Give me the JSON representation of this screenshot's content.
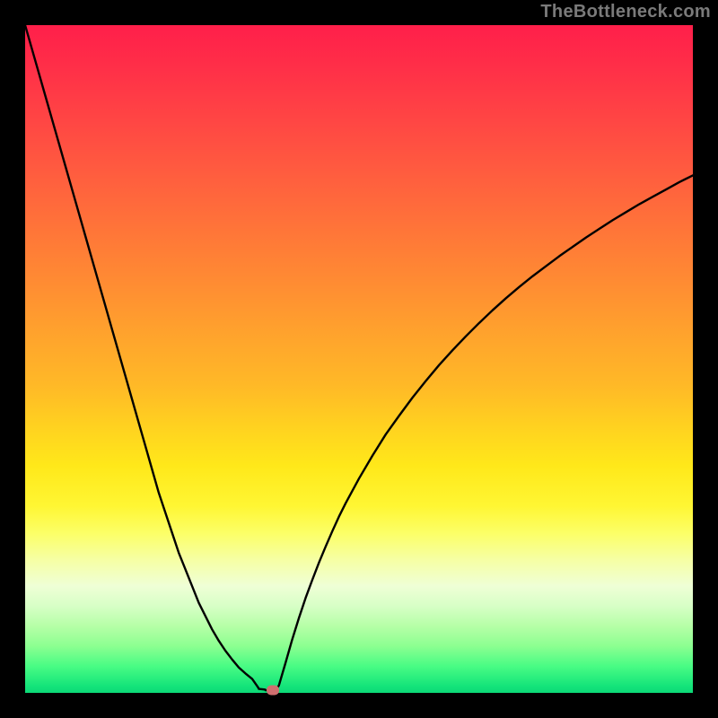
{
  "watermark": "TheBottleneck.com",
  "chart_data": {
    "type": "line",
    "title": "",
    "xlabel": "",
    "ylabel": "",
    "xlim": [
      0,
      100
    ],
    "ylim": [
      0,
      100
    ],
    "grid": false,
    "legend": false,
    "x": [
      0,
      1,
      2,
      3,
      4,
      5,
      6,
      7,
      8,
      9,
      10,
      11,
      12,
      13,
      14,
      15,
      16,
      17,
      18,
      19,
      20,
      21,
      22,
      23,
      24,
      25,
      26,
      27,
      28,
      29,
      30,
      31,
      32,
      33,
      34,
      34.9,
      35.0,
      35.9,
      36.0,
      36.9,
      37.0,
      37.5,
      38,
      39,
      40,
      41,
      42,
      43,
      44,
      45,
      46,
      47,
      48,
      50,
      52,
      54,
      56,
      58,
      60,
      62,
      64,
      66,
      68,
      70,
      72,
      74,
      76,
      78,
      80,
      82,
      84,
      86,
      88,
      90,
      92,
      94,
      96,
      98,
      100
    ],
    "y": [
      100.0,
      96.5,
      93.0,
      89.5,
      86.0,
      82.5,
      79.0,
      75.5,
      72.0,
      68.5,
      65.0,
      61.5,
      58.0,
      54.5,
      51.0,
      47.5,
      44.0,
      40.5,
      37.0,
      33.5,
      30.0,
      27.0,
      24.0,
      21.0,
      18.5,
      16.0,
      13.5,
      11.5,
      9.5,
      7.8,
      6.3,
      5.0,
      3.8,
      2.9,
      2.1,
      0.8,
      0.6,
      0.5,
      0.4,
      0.4,
      0.4,
      0.4,
      1.1,
      4.5,
      8.0,
      11.2,
      14.2,
      16.9,
      19.5,
      21.9,
      24.2,
      26.4,
      28.4,
      32.1,
      35.5,
      38.7,
      41.5,
      44.2,
      46.7,
      49.1,
      51.3,
      53.4,
      55.4,
      57.3,
      59.1,
      60.8,
      62.4,
      63.9,
      65.4,
      66.8,
      68.2,
      69.5,
      70.8,
      72.0,
      73.2,
      74.3,
      75.4,
      76.5,
      77.5
    ],
    "marker": {
      "x": 37.1,
      "y": 0.4
    },
    "gradient_stops": [
      {
        "pct": 0,
        "color": "#ff1f4a"
      },
      {
        "pct": 25,
        "color": "#ff7a36"
      },
      {
        "pct": 50,
        "color": "#ffc824"
      },
      {
        "pct": 72,
        "color": "#ffff30"
      },
      {
        "pct": 86,
        "color": "#e6ffcc"
      },
      {
        "pct": 100,
        "color": "#0cd877"
      }
    ]
  }
}
